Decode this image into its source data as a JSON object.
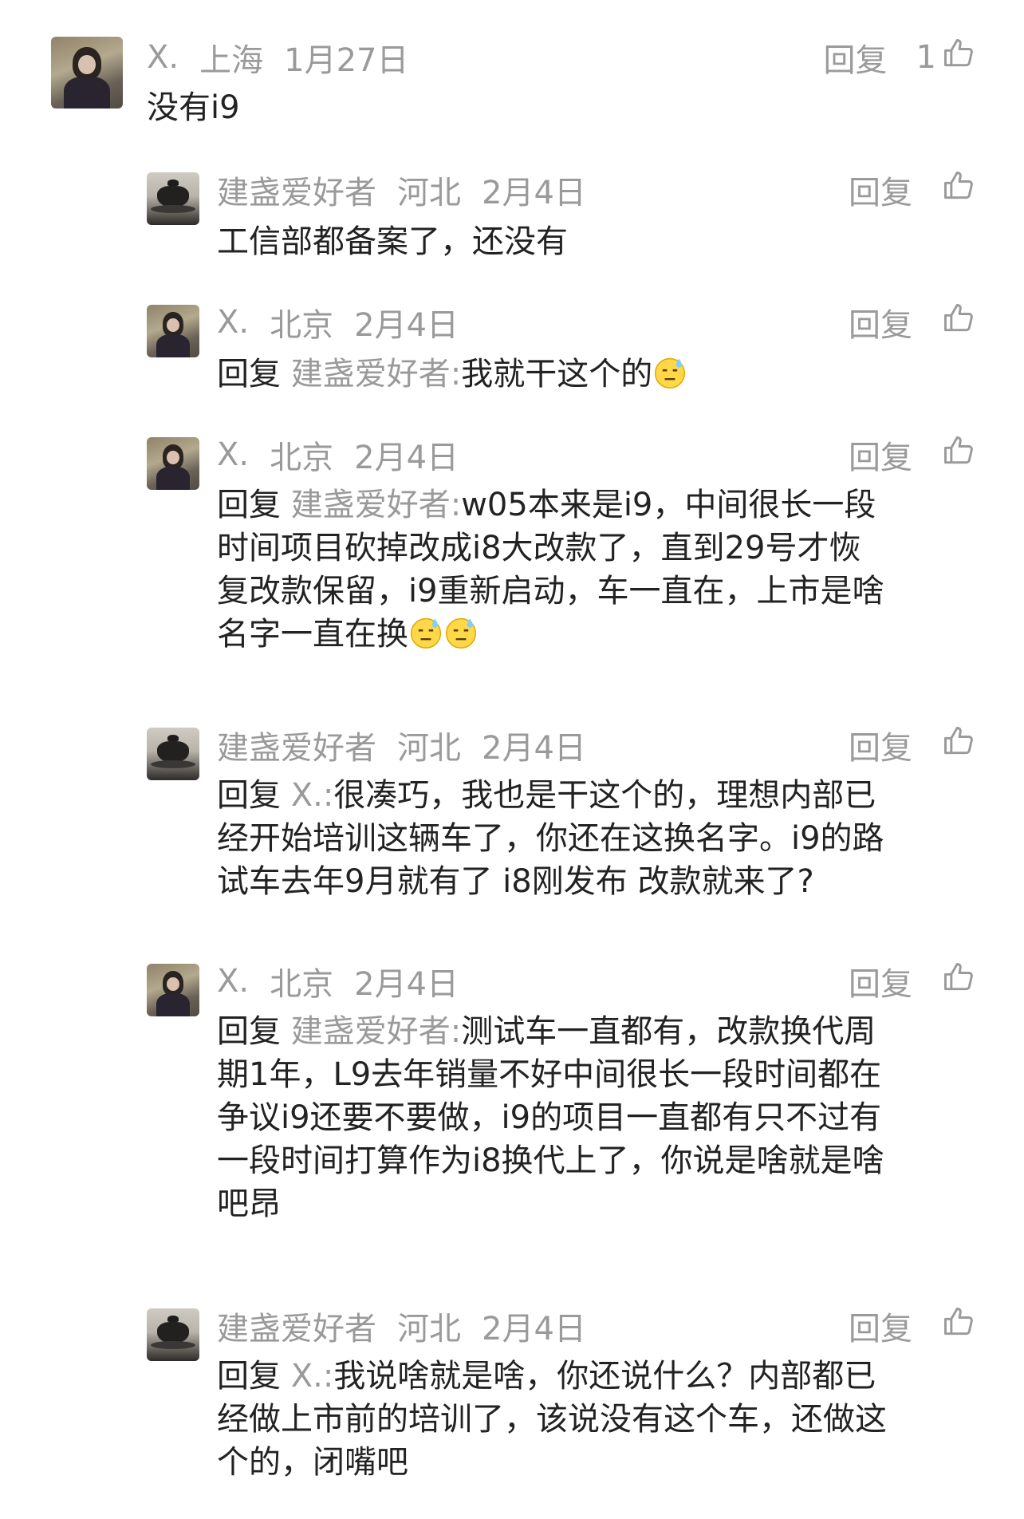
{
  "labels": {
    "reply_action": "回复",
    "reply_prefix": "回复"
  },
  "comments": [
    {
      "user": "X.",
      "location": "上海",
      "date": "1月27日",
      "likes": "1",
      "text": "没有i9"
    },
    {
      "user": "建盏爱好者",
      "location": "河北",
      "date": "2月4日",
      "text": "工信部都备案了，还没有"
    },
    {
      "user": "X.",
      "location": "北京",
      "date": "2月4日",
      "reply_to": "建盏爱好者:",
      "text": "我就干这个的"
    },
    {
      "user": "X.",
      "location": "北京",
      "date": "2月4日",
      "reply_to": "建盏爱好者:",
      "lines": [
        "w05本来是i9，中间很长一段",
        "时间项目砍掉改成i8大改款了，直到29号才恢",
        "复改款保留，i9重新启动，车一直在，上市是啥",
        "名字一直在换"
      ]
    },
    {
      "user": "建盏爱好者",
      "location": "河北",
      "date": "2月4日",
      "reply_to": "X.:",
      "lines": [
        "很凑巧，我也是干这个的，理想内部已",
        "经开始培训这辆车了，你还在这换名字。i9的路",
        "试车去年9月就有了 i8刚发布 改款就来了?"
      ]
    },
    {
      "user": "X.",
      "location": "北京",
      "date": "2月4日",
      "reply_to": "建盏爱好者:",
      "lines": [
        "测试车一直都有，改款换代周",
        "期1年，L9去年销量不好中间很长一段时间都在",
        "争议i9还要不要做，i9的项目一直都有只不过有",
        "一段时间打算作为i8换代上了，你说是啥就是啥",
        "吧昂"
      ]
    },
    {
      "user": "建盏爱好者",
      "location": "河北",
      "date": "2月4日",
      "reply_to": "X.:",
      "lines": [
        "我说啥就是啥，你还说什么？内部都已",
        "经做上市前的培训了，该说没有这个车，还做这",
        "个的，闭嘴吧"
      ]
    }
  ]
}
